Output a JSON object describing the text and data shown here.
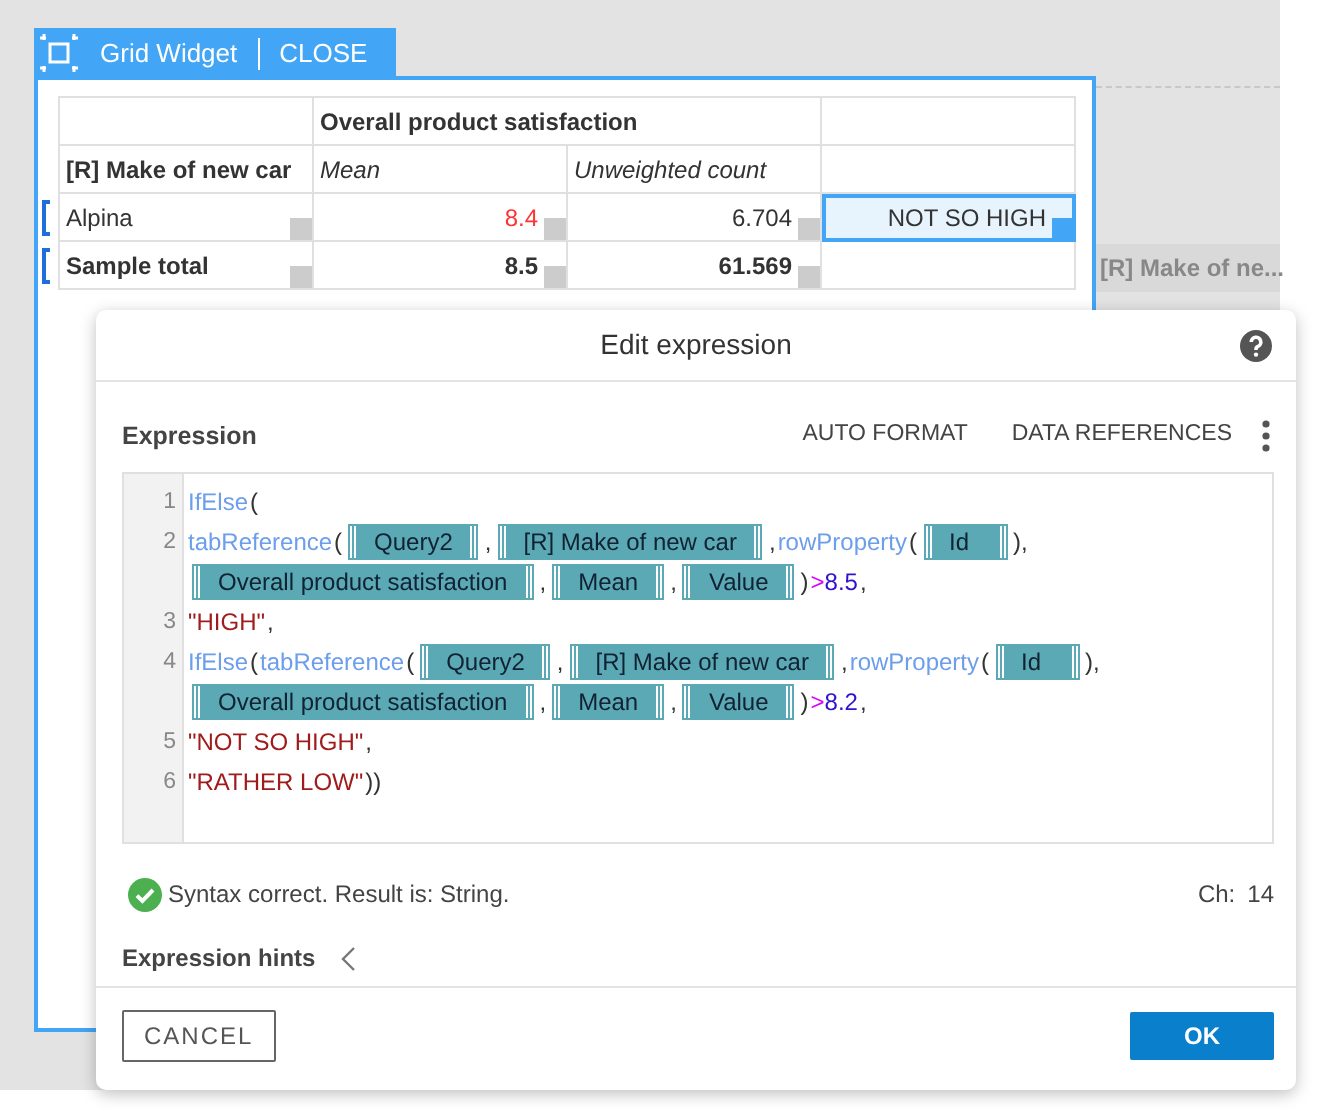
{
  "widget": {
    "title": "Grid Widget",
    "close": "CLOSE",
    "table": {
      "header_rows": [
        [
          "",
          "Overall product satisfaction",
          ""
        ],
        [
          "[R] Make of new car",
          "Mean",
          "Unweighted count",
          ""
        ]
      ],
      "rows": [
        {
          "label": "Alpina",
          "bold": false,
          "cells": [
            {
              "text": "8.4",
              "alert": true,
              "fx": true
            },
            {
              "text": "6.704",
              "alert": false,
              "fx": true
            },
            {
              "text": "NOT SO HIGH",
              "alert": false,
              "fx": true,
              "selected": true
            }
          ]
        },
        {
          "label": "Sample total",
          "bold": true,
          "cells": [
            {
              "text": "8.5",
              "alert": false,
              "fx": true
            },
            {
              "text": "61.569",
              "alert": false,
              "fx": true
            },
            {
              "text": "",
              "fx": false,
              "selected": false
            }
          ]
        }
      ]
    }
  },
  "background_label": "[R] Make of ne...",
  "dialog": {
    "title": "Edit expression",
    "section": "Expression",
    "actions": [
      "AUTO FORMAT",
      "DATA REFERENCES"
    ],
    "code": [
      {
        "number": "1",
        "tokens": [
          {
            "kind": "func",
            "text": "IfElse"
          },
          {
            "kind": "plain",
            "text": "("
          }
        ]
      },
      {
        "number": "2",
        "tokens": [
          {
            "kind": "func",
            "text": "tabReference"
          },
          {
            "kind": "plain",
            "text": "("
          },
          {
            "kind": "chip",
            "text": "Query2"
          },
          {
            "kind": "plain",
            "text": ","
          },
          {
            "kind": "chip",
            "text": "[R] Make of new car"
          },
          {
            "kind": "plain",
            "text": ","
          },
          {
            "kind": "func",
            "text": "rowProperty"
          },
          {
            "kind": "plain",
            "text": "("
          },
          {
            "kind": "chip",
            "text": "Id"
          },
          {
            "kind": "plain",
            "text": "),"
          }
        ]
      },
      {
        "tokens": [
          {
            "kind": "chip",
            "text": "Overall product satisfaction"
          },
          {
            "kind": "plain",
            "text": ","
          },
          {
            "kind": "chip",
            "text": "Mean"
          },
          {
            "kind": "plain",
            "text": ","
          },
          {
            "kind": "chip",
            "text": "Value"
          },
          {
            "kind": "plain",
            "text": ")"
          },
          {
            "kind": "op",
            "text": ">"
          },
          {
            "kind": "num",
            "text": "8.5"
          },
          {
            "kind": "plain",
            "text": ","
          }
        ]
      },
      {
        "number": "3",
        "tokens": [
          {
            "kind": "str",
            "text": "\"HIGH\""
          },
          {
            "kind": "plain",
            "text": ","
          }
        ]
      },
      {
        "number": "4",
        "tokens": [
          {
            "kind": "func",
            "text": "IfElse"
          },
          {
            "kind": "plain",
            "text": "("
          },
          {
            "kind": "func",
            "text": "tabReference"
          },
          {
            "kind": "plain",
            "text": "("
          },
          {
            "kind": "chip",
            "text": "Query2"
          },
          {
            "kind": "plain",
            "text": ","
          },
          {
            "kind": "chip",
            "text": "[R] Make of new car"
          },
          {
            "kind": "plain",
            "text": ","
          },
          {
            "kind": "func",
            "text": "rowProperty"
          },
          {
            "kind": "plain",
            "text": "("
          },
          {
            "kind": "chip",
            "text": "Id"
          },
          {
            "kind": "plain",
            "text": "),"
          }
        ]
      },
      {
        "tokens": [
          {
            "kind": "chip",
            "text": "Overall product satisfaction"
          },
          {
            "kind": "plain",
            "text": ","
          },
          {
            "kind": "chip",
            "text": "Mean"
          },
          {
            "kind": "plain",
            "text": ","
          },
          {
            "kind": "chip",
            "text": "Value"
          },
          {
            "kind": "plain",
            "text": ")"
          },
          {
            "kind": "op",
            "text": ">"
          },
          {
            "kind": "num",
            "text": "8.2"
          },
          {
            "kind": "plain",
            "text": ","
          }
        ]
      },
      {
        "number": "5",
        "tokens": [
          {
            "kind": "str",
            "text": "\"NOT SO HIGH\""
          },
          {
            "kind": "plain",
            "text": ","
          }
        ]
      },
      {
        "number": "6",
        "tokens": [
          {
            "kind": "str",
            "text": "\"RATHER LOW\""
          },
          {
            "kind": "plain",
            "text": "))"
          }
        ]
      }
    ],
    "status": {
      "ok": true,
      "text": "Syntax correct. Result is: String.",
      "ch_label": "Ch:",
      "ch_value": "14"
    },
    "hints": {
      "label": "Expression hints",
      "expanded": false
    },
    "cancel": "CANCEL",
    "ok": "OK"
  }
}
